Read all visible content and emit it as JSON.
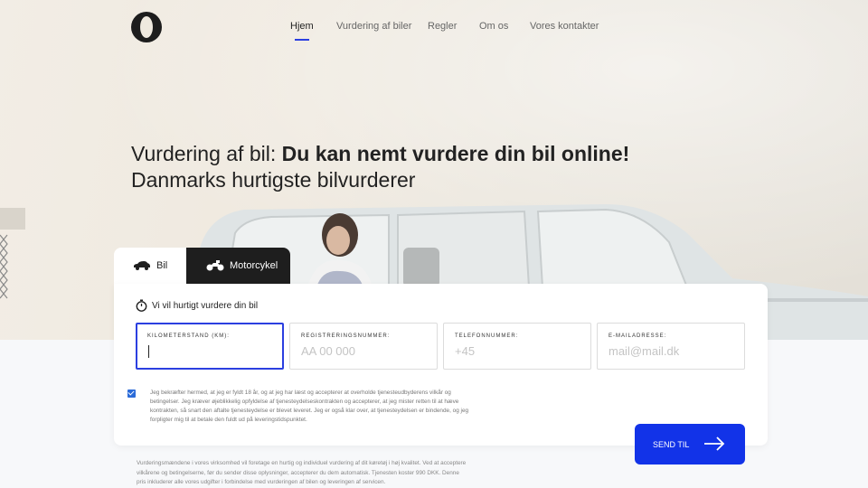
{
  "nav": {
    "items": [
      {
        "label": "Hjem",
        "active": true
      },
      {
        "label": "Vurdering af biler",
        "active": false
      },
      {
        "label": "Regler",
        "active": false
      },
      {
        "label": "Om os",
        "active": false
      },
      {
        "label": "Vores kontakter",
        "active": false
      }
    ]
  },
  "hero": {
    "title_prefix": "Vurdering af bil: ",
    "title_bold": "Du kan nemt vurdere din bil online!",
    "subtitle": "Danmarks hurtigste bilvurderer"
  },
  "tabs": {
    "bil": {
      "label": "Bil",
      "icon": "car-icon"
    },
    "motorcykel": {
      "label": "Motorcykel",
      "icon": "motorcycle-icon"
    }
  },
  "form": {
    "title": "Vi vil hurtigt vurdere din bil",
    "title_icon": "stopwatch-icon",
    "fields": {
      "km": {
        "label": "KILOMETERSTAND (KM):",
        "value": "",
        "placeholder": ""
      },
      "reg": {
        "label": "REGISTRERINGSNUMMER:",
        "value": "",
        "placeholder": "AA 00 000"
      },
      "phone": {
        "label": "TELEFONNUMMER:",
        "value": "",
        "placeholder": "+45"
      },
      "email": {
        "label": "E-MAILADRESSE:",
        "value": "",
        "placeholder": "mail@mail.dk"
      }
    },
    "consent_checked": true,
    "consent_text": "Jeg bekræfter hermed, at jeg er fyldt 18 år, og at jeg har læst og accepterer at overholde tjenesteudbyderens vilkår og betingelser. Jeg kræver øjeblikkelig opfyldelse af tjenesteydelseskontrakten og accepterer, at jeg mister retten til at hæve kontrakten, så snart den aftalte tjenesteydelse er blevet leveret. Jeg er også klar over, at tjenesteydelsen er bindende, og jeg forpligter mig til at betale den fuldt ud på leveringstidspunktet.",
    "submit_label": "SEND TIL"
  },
  "footnote": "Vurderingsmændene i vores virksomhed vil foretage en hurtig og individuel vurdering af dit køretøj i høj kvalitet. Ved at acceptere vilkårene og betingelserne, før du sender disse oplysninger, accepterer du dem automatisk. Tjenesten koster 990 DKK. Denne pris inkluderer alle vores udgifter i forbindelse med vurderingen af bilen og leveringen af servicen.",
  "colors": {
    "accent": "#1233e8",
    "nav_underline": "#2b3fe0",
    "dark_tab": "#1e1e1e"
  }
}
